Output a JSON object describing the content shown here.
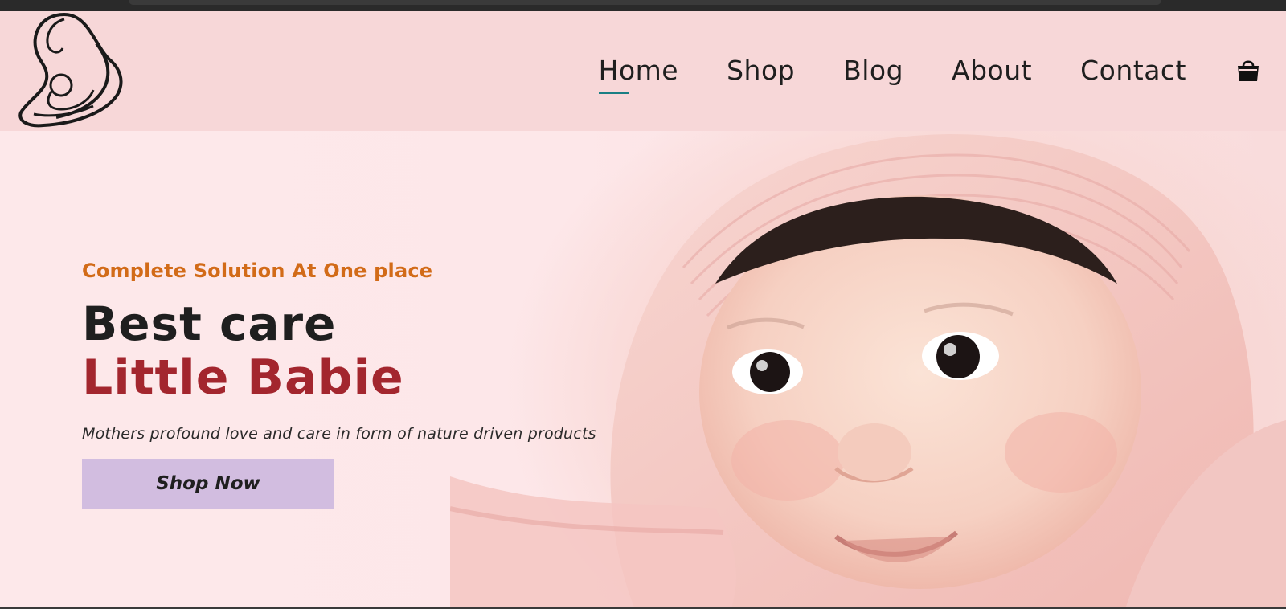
{
  "nav": {
    "items": [
      {
        "label": "Home",
        "active": true
      },
      {
        "label": "Shop",
        "active": false
      },
      {
        "label": "Blog",
        "active": false
      },
      {
        "label": "About",
        "active": false
      },
      {
        "label": "Contact",
        "active": false
      }
    ],
    "cart_icon": "shopping-bag-icon"
  },
  "logo": {
    "icon": "mother-and-baby-logo"
  },
  "hero": {
    "eyebrow": "Complete Solution At One place",
    "title_line1": "Best care",
    "title_line2": "Little Babie",
    "tagline": "Mothers profound love and care in form of nature driven products",
    "cta_label": "Shop Now"
  },
  "colors": {
    "header_bg": "#f7d7d8",
    "eyebrow": "#d26b18",
    "title_primary": "#1f1f1f",
    "title_accent": "#a3262e",
    "cta_bg": "#d2bde0",
    "nav_underline": "#1a7f84"
  }
}
